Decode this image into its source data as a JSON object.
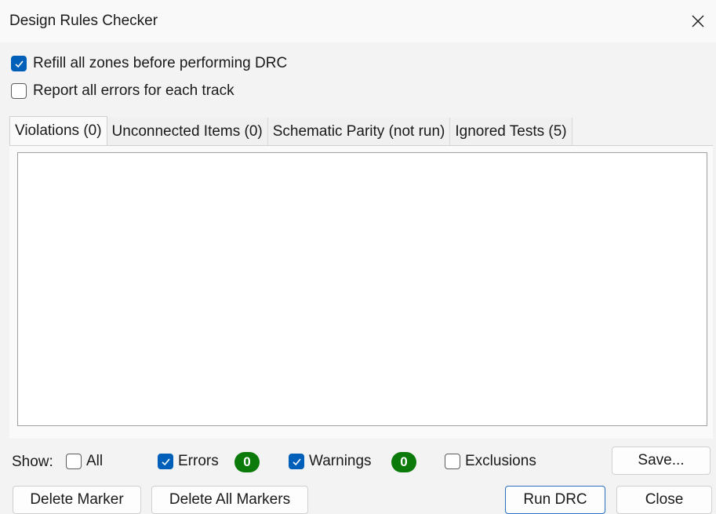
{
  "window": {
    "title": "Design Rules Checker"
  },
  "options": {
    "refill_zones": {
      "label": "Refill all zones before performing DRC",
      "checked": true
    },
    "report_all_errors": {
      "label": "Report all errors for each track",
      "checked": false
    }
  },
  "tabs": [
    {
      "label": "Violations (0)",
      "active": true
    },
    {
      "label": "Unconnected Items (0)",
      "active": false
    },
    {
      "label": "Schematic Parity (not run)",
      "active": false
    },
    {
      "label": "Ignored Tests (5)",
      "active": false
    }
  ],
  "filters": {
    "show_label": "Show:",
    "all": {
      "label": "All",
      "checked": false
    },
    "errors": {
      "label": "Errors",
      "checked": true,
      "count": "0"
    },
    "warnings": {
      "label": "Warnings",
      "checked": true,
      "count": "0"
    },
    "exclusions": {
      "label": "Exclusions",
      "checked": false
    }
  },
  "buttons": {
    "save": "Save...",
    "delete_marker": "Delete Marker",
    "delete_all_markers": "Delete All Markers",
    "run_drc": "Run DRC",
    "close": "Close"
  },
  "colors": {
    "accent": "#005fb8",
    "badge": "#0b7a0b"
  }
}
